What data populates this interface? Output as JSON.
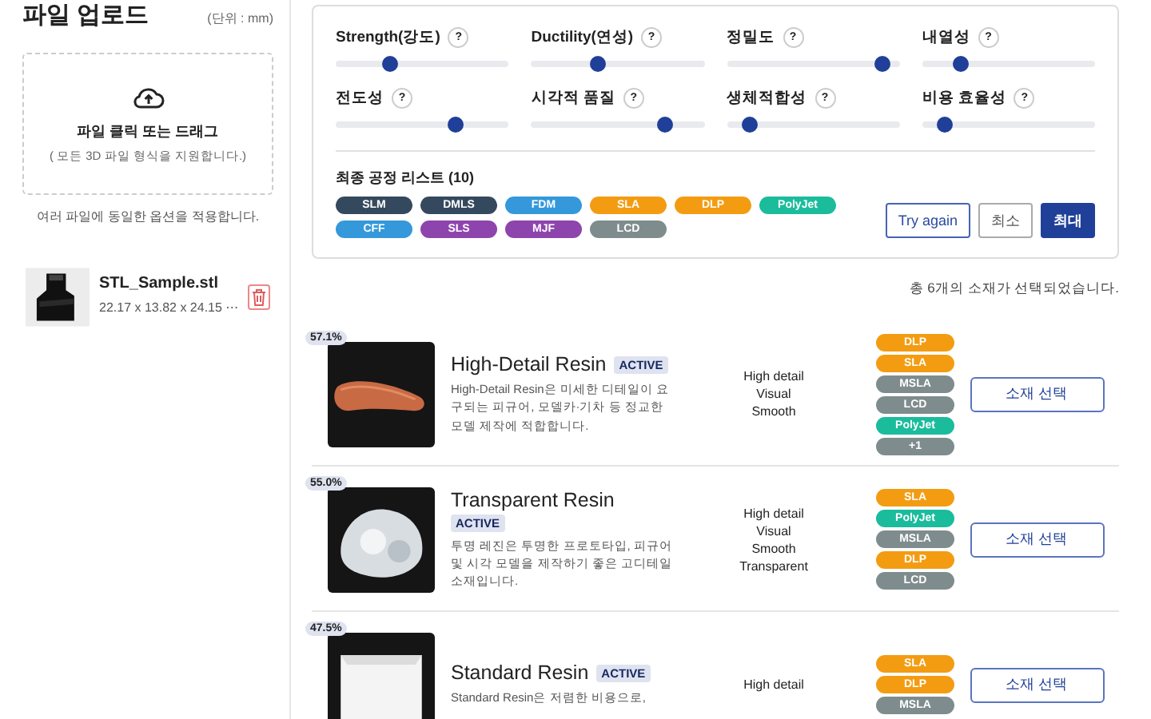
{
  "sidebar": {
    "title": "파일 업로드",
    "unit": "(단위 : mm)",
    "dropzone": {
      "title": "파일 클릭 또는 드래그",
      "hint": "( 모든 3D 파일 형식을 지원합니다.)"
    },
    "note": "여러 파일에 동일한 옵션을 적용합니다.",
    "files": [
      {
        "name": "STL_Sample.stl",
        "size": "22.17 x 13.82 x 24.15 ⋯"
      }
    ]
  },
  "filters": {
    "sliders": [
      {
        "label": "Strength(강도)",
        "help": "?",
        "level": 0.31
      },
      {
        "label": "Ductility(연성)",
        "help": "?",
        "level": 0.39
      },
      {
        "label": "정밀도",
        "help": "?",
        "level": 0.9
      },
      {
        "label": "내열성",
        "help": "?",
        "level": 0.22
      },
      {
        "label": "전도성",
        "help": "?",
        "level": 0.69
      },
      {
        "label": "시각적 품질",
        "help": "?",
        "level": 0.77
      },
      {
        "label": "생체적합성",
        "help": "?",
        "level": 0.13
      },
      {
        "label": "비용 효율성",
        "help": "?",
        "level": 0.13
      }
    ],
    "process_title": "최종 공정 리스트 (10)",
    "processes": [
      {
        "label": "SLM",
        "color": "#34495e"
      },
      {
        "label": "DMLS",
        "color": "#34495e"
      },
      {
        "label": "FDM",
        "color": "#3498db"
      },
      {
        "label": "SLA",
        "color": "#f39c12"
      },
      {
        "label": "DLP",
        "color": "#f39c12"
      },
      {
        "label": "PolyJet",
        "color": "#1abc9c"
      },
      {
        "label": "CFF",
        "color": "#3498db"
      },
      {
        "label": "SLS",
        "color": "#8e44ad"
      },
      {
        "label": "MJF",
        "color": "#8e44ad"
      },
      {
        "label": "LCD",
        "color": "#7f8c8d"
      }
    ],
    "buttons": [
      {
        "label": "Try again",
        "kind": "outline"
      },
      {
        "label": "최소",
        "kind": "plain"
      },
      {
        "label": "최대",
        "kind": "primary"
      }
    ]
  },
  "summary": "총 6개의 소재가 선택되었습니다.",
  "materials": [
    {
      "match": "57.1%",
      "name": "High-Detail Resin",
      "status": "ACTIVE",
      "description": "High-Detail Resin은 미세한 디테일이 요구되는 피규어, 모델카·기차 등 정교한 모델 제작에 적합합니다.",
      "features": [
        "High detail",
        "Visual",
        "Smooth"
      ],
      "processes": [
        {
          "label": "DLP",
          "color": "#f39c12"
        },
        {
          "label": "SLA",
          "color": "#f39c12"
        },
        {
          "label": "MSLA",
          "color": "#7f8c8d"
        },
        {
          "label": "LCD",
          "color": "#7f8c8d"
        },
        {
          "label": "PolyJet",
          "color": "#1abc9c"
        },
        {
          "label": "+1",
          "color": "#7f8c8d"
        }
      ],
      "button": "소재 선택"
    },
    {
      "match": "55.0%",
      "name": "Transparent Resin",
      "status": "ACTIVE",
      "description": "투명 레진은 투명한 프로토타입, 피규어 및 시각 모델을 제작하기 좋은 고디테일 소재입니다.",
      "features": [
        "High detail",
        "Visual",
        "Smooth",
        "Transparent"
      ],
      "processes": [
        {
          "label": "SLA",
          "color": "#f39c12"
        },
        {
          "label": "PolyJet",
          "color": "#1abc9c"
        },
        {
          "label": "MSLA",
          "color": "#7f8c8d"
        },
        {
          "label": "DLP",
          "color": "#f39c12"
        },
        {
          "label": "LCD",
          "color": "#7f8c8d"
        }
      ],
      "button": "소재 선택"
    },
    {
      "match": "47.5%",
      "name": "Standard Resin",
      "status": "ACTIVE",
      "description": "Standard Resin은 저렴한 비용으로,",
      "features": [
        "High detail"
      ],
      "processes": [
        {
          "label": "SLA",
          "color": "#f39c12"
        },
        {
          "label": "DLP",
          "color": "#f39c12"
        },
        {
          "label": "MSLA",
          "color": "#7f8c8d"
        }
      ],
      "button": "소재 선택"
    }
  ]
}
